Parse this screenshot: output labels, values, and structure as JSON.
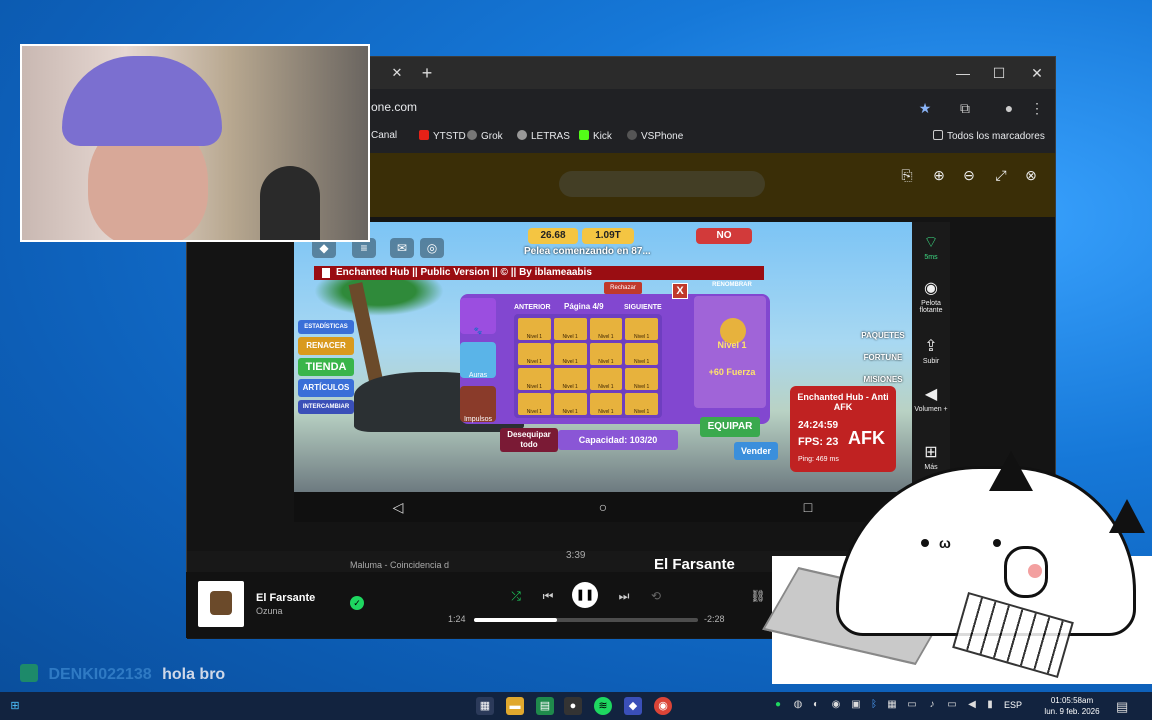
{
  "browser": {
    "url": "one.com",
    "bookmarks": [
      "Canal",
      "YTSTD",
      "Grok",
      "LETRAS",
      "Kick",
      "VSPhone"
    ],
    "all_bookmarks": "Todos los marcadores"
  },
  "game": {
    "coins": "26.68",
    "currency2": "1.09T",
    "fight_text": "Pelea comenzando en 87...",
    "hub_title": "Enchanted Hub || Public Version || © || By iblameaabis",
    "left_menu": [
      "ESTADÍSTICAS",
      "RENACER",
      "TIENDA",
      "ARTÍCULOS",
      "INTERCAMBIAR"
    ],
    "side_tabs": [
      "Auras",
      "Impulsos"
    ],
    "nav": {
      "prev": "ANTERIOR",
      "page": "Página 4/9",
      "next": "SIGUIENTE"
    },
    "reject": "Rechazar",
    "close": "X",
    "rename": "RENOMBRAR",
    "cell_label": "Nivel 1",
    "level": "Nivel 1",
    "strength": "+60 Fuerza",
    "unequip_all": "Desequipar todo",
    "capacity": "Capacidad: 103/20",
    "equip": "EQUIPAR",
    "sell": "Vender",
    "right_menu": [
      "PAQUETES",
      "FORTUNE",
      "MISIONES"
    ],
    "afk": {
      "title": "Enchanted Hub - Anti AFK",
      "time": "24:24:59",
      "fps": "FPS: 23",
      "big": "AFK",
      "ping": "Ping: 469 ms"
    }
  },
  "emulator": {
    "items": [
      {
        "label": "5ms",
        "icon": "wifi-icon"
      },
      {
        "label": "Pelota flotante",
        "icon": "record-icon"
      },
      {
        "label": "Subir",
        "icon": "upload-icon"
      },
      {
        "label": "Volumen +",
        "icon": "volume-icon"
      },
      {
        "label": "Más",
        "icon": "grid-icon"
      }
    ]
  },
  "music": {
    "queue_time": "3:39",
    "queue_track": "Maluma - Coincidencia d",
    "now_playing_big": "El Farsante",
    "song": "El Farsante",
    "artist": "Ozuna",
    "elapsed": "1:24",
    "remaining": "-2:28",
    "progress": 0.37
  },
  "chat": {
    "user": "DENKI022138",
    "message": "hola bro"
  },
  "taskbar": {
    "lang": "ESP",
    "time": "01:05:58am",
    "date": "lun. 9 feb. 2026"
  },
  "colors": {
    "accent_red": "#c02222",
    "spotify_green": "#1ed760",
    "game_purple": "#8247d0"
  }
}
